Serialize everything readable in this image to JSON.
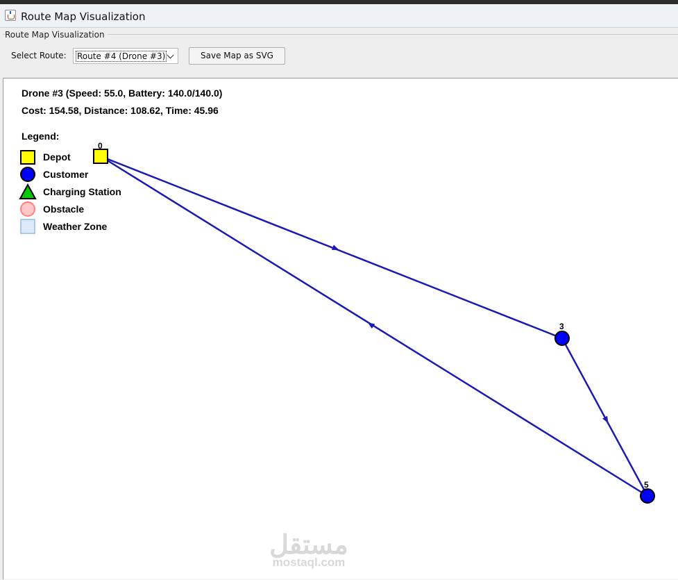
{
  "window": {
    "title": "Route Map Visualization"
  },
  "panel": {
    "group_title": "Route Map Visualization"
  },
  "toolbar": {
    "select_label": "Select Route:",
    "route_selected": "Route #4 (Drone #3)",
    "save_button": "Save Map as SVG"
  },
  "info": {
    "drone_line": "Drone #3 (Speed: 55.0, Battery: 140.0/140.0)",
    "cost_line": "Cost: 154.58, Distance: 108.62, Time: 45.96"
  },
  "legend": {
    "title": "Legend:",
    "items": [
      {
        "label": "Depot",
        "shape": "square",
        "color": "#ffff00",
        "stroke": "#000000"
      },
      {
        "label": "Customer",
        "shape": "circle",
        "color": "#0000ff",
        "stroke": "#000000"
      },
      {
        "label": "Charging Station",
        "shape": "triangle",
        "color": "#00cc00",
        "stroke": "#000000"
      },
      {
        "label": "Obstacle",
        "shape": "circle",
        "color": "#ffc8c8",
        "stroke": "#ff8080"
      },
      {
        "label": "Weather Zone",
        "shape": "square",
        "color": "#dde8f8",
        "stroke": "#a8c8ee"
      }
    ]
  },
  "map": {
    "nodes": [
      {
        "id": "0",
        "type": "depot"
      },
      {
        "id": "3",
        "type": "customer"
      },
      {
        "id": "5",
        "type": "customer"
      }
    ],
    "route": [
      "0",
      "3",
      "5",
      "0"
    ],
    "route_color": "#1a1ab4"
  },
  "watermark": {
    "arabic": "مستقل",
    "latin": "mostaql.com"
  }
}
